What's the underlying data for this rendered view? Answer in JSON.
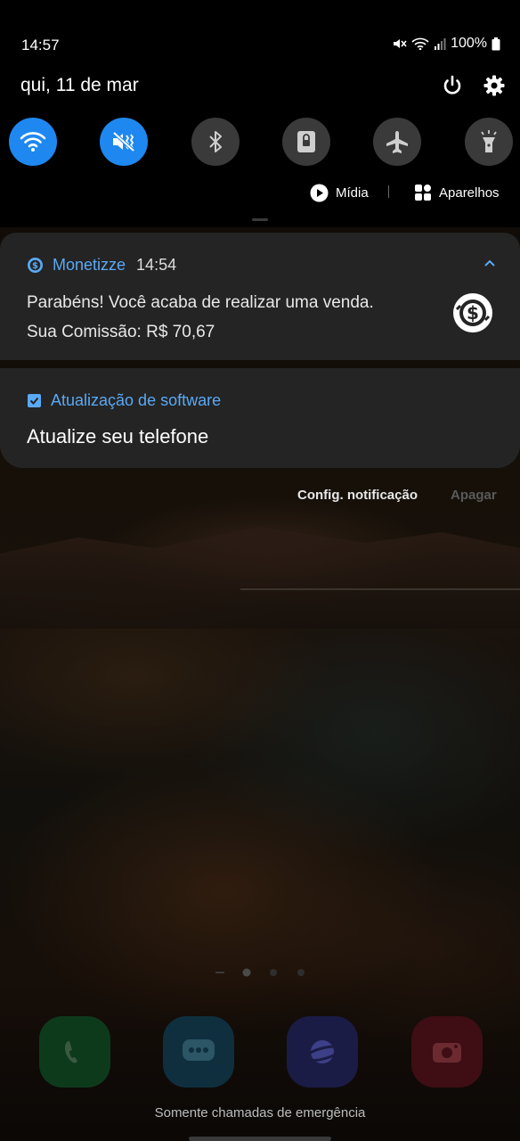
{
  "status_bar": {
    "time": "14:57",
    "battery": "100%"
  },
  "header": {
    "date": "qui, 11 de mar"
  },
  "quick_settings": {
    "tiles": [
      {
        "name": "wifi",
        "state": "on"
      },
      {
        "name": "vibrate",
        "state": "on"
      },
      {
        "name": "bluetooth",
        "state": "off"
      },
      {
        "name": "screen-lock",
        "state": "off"
      },
      {
        "name": "airplane-mode",
        "state": "off"
      },
      {
        "name": "flashlight",
        "state": "off"
      }
    ],
    "media_label": "Mídia",
    "devices_label": "Aparelhos"
  },
  "notifications": [
    {
      "app": "Monetizze",
      "time": "14:54",
      "line1": "Parabéns! Você acaba de realizar uma venda.",
      "line2": "Sua Comissão: R$ 70,67"
    },
    {
      "app": "Atualização de software",
      "title": "Atualize seu telefone"
    }
  ],
  "actions": {
    "config": "Config. notificação",
    "clear": "Apagar"
  },
  "lockscreen": {
    "emergency_text": "Somente chamadas de emergência"
  },
  "colors": {
    "accent": "#1e88f0",
    "link": "#5aa9f5",
    "card": "#242424"
  }
}
